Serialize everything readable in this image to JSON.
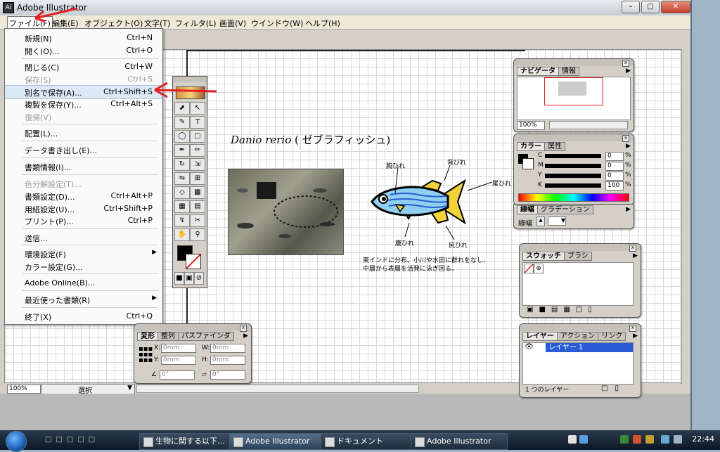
{
  "window": {
    "title": "Adobe Illustrator"
  },
  "menubar": [
    {
      "label": "ファイル(F)",
      "active": true
    },
    {
      "label": "編集(E)"
    },
    {
      "label": "オブジェクト(O)"
    },
    {
      "label": "文字(T)"
    },
    {
      "label": "フィルタ(L)"
    },
    {
      "label": "画面(V)"
    },
    {
      "label": "ウインドウ(W)"
    },
    {
      "label": "ヘルプ(H)"
    }
  ],
  "file_menu": [
    {
      "label": "新規(N)",
      "shortcut": "Ctrl+N"
    },
    {
      "label": "開く(O)...",
      "shortcut": "Ctrl+O"
    },
    {
      "label": "閉じる(C)",
      "shortcut": "Ctrl+W"
    },
    {
      "label": "保存(S)",
      "shortcut": "Ctrl+S",
      "disabled": true
    },
    {
      "label": "別名で保存(A)...",
      "shortcut": "Ctrl+Shift+S",
      "highlighted": true
    },
    {
      "label": "複製を保存(Y)...",
      "shortcut": "Ctrl+Alt+S"
    },
    {
      "label": "復帰(V)",
      "shortcut": "",
      "disabled": true
    },
    {
      "label": "配置(L)...",
      "shortcut": ""
    },
    {
      "label": "データ書き出し(E)...",
      "shortcut": ""
    },
    {
      "label": "書類情報(I)...",
      "shortcut": ""
    },
    {
      "label": "色分解設定(T)...",
      "shortcut": "",
      "disabled": true
    },
    {
      "label": "書類設定(D)...",
      "shortcut": "Ctrl+Alt+P"
    },
    {
      "label": "用紙設定(U)...",
      "shortcut": "Ctrl+Shift+P"
    },
    {
      "label": "プリント(P)...",
      "shortcut": "Ctrl+P"
    },
    {
      "label": "送信...",
      "shortcut": ""
    },
    {
      "label": "環境設定(F)",
      "shortcut": "",
      "submenu": true
    },
    {
      "label": "カラー設定(G)...",
      "shortcut": ""
    },
    {
      "label": "Adobe Online(B)...",
      "shortcut": ""
    },
    {
      "label": "最近使った書類(R)",
      "shortcut": "",
      "submenu": true
    },
    {
      "label": "終了(X)",
      "shortcut": "Ctrl+Q"
    }
  ],
  "artwork": {
    "title_italic": "Danio rerio",
    "title_rest": " ( ゼブラフィッシュ)",
    "labels": {
      "mune": "胸ひれ",
      "se": "背びれ",
      "o": "尾ひれ",
      "hara": "腹ひれ",
      "shiri": "尻ひれ"
    },
    "desc_line1": "東インドに分布。小川や水田に群れをなし、",
    "desc_line2": "中層から表層を活発に泳ぎ回る。"
  },
  "status": {
    "zoom": "100%",
    "mode": "選択"
  },
  "navigator": {
    "tabs": [
      "ナビゲータ",
      "情報"
    ],
    "zoom": "100%"
  },
  "color_panel": {
    "tabs": [
      "カラー",
      "属性"
    ],
    "channels": [
      {
        "name": "C",
        "value": "0"
      },
      {
        "name": "M",
        "value": "0"
      },
      {
        "name": "Y",
        "value": "0"
      },
      {
        "name": "K",
        "value": "100"
      }
    ],
    "unit": "%"
  },
  "stroke_panel": {
    "tabs": [
      "線幅",
      "グラデーション"
    ],
    "label": "線幅"
  },
  "swatch_panel": {
    "tabs": [
      "スウォッチ",
      "ブラシ"
    ]
  },
  "layers_panel": {
    "tabs": [
      "レイヤー",
      "アクション",
      "リンク"
    ],
    "layer_name": "レイヤー 1",
    "footer": "1 つのレイヤー"
  },
  "transform_panel": {
    "tabs": [
      "変形",
      "整列",
      "パスファインダ"
    ],
    "x_label": "X:",
    "x_value": "0mm",
    "y_label": "Y:",
    "y_value": "0mm",
    "w_label": "W:",
    "w_value": "0mm",
    "h_label": "H:",
    "h_value": "0mm",
    "angle1": "0°",
    "angle2": "0°"
  },
  "taskbar": {
    "buttons": [
      {
        "label": "生物に関する以下..."
      },
      {
        "label": "Adobe Illustrator",
        "active": true
      },
      {
        "label": "ドキュメント"
      },
      {
        "label": "Adobe Illustrator"
      }
    ],
    "clock": "22:44"
  },
  "colors": {
    "accent_red": "#e31e24",
    "fish_blue": "#8fd0f0",
    "fish_yellow": "#f3d23a",
    "layer_blue": "#2a5bd7"
  }
}
